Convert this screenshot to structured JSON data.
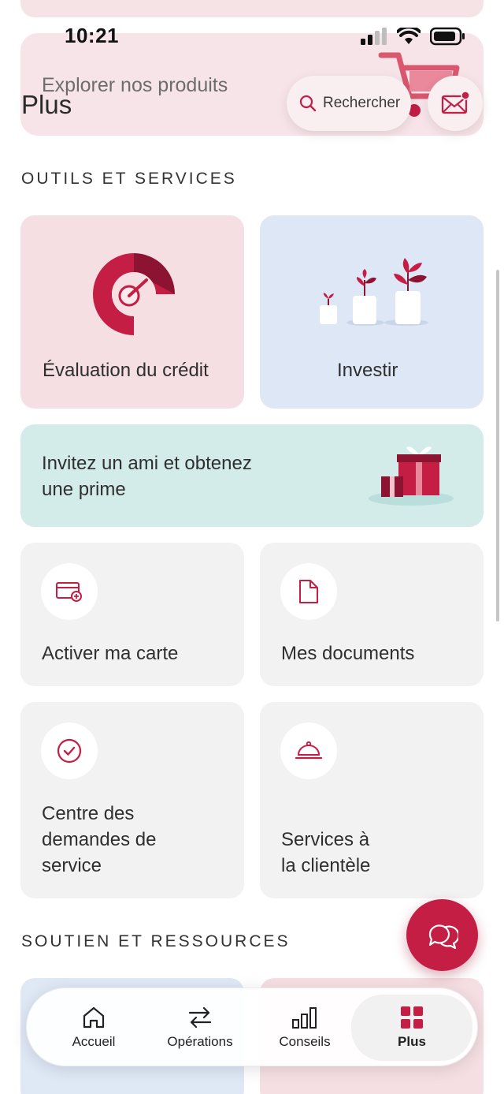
{
  "status_bar": {
    "time": "10:21"
  },
  "header": {
    "title": "Plus",
    "promo_text": "Explorer nos produits",
    "search_label": "Rechercher"
  },
  "sections": {
    "tools_title": "OUTILS ET SERVICES",
    "support_title": "SOUTIEN ET RESSOURCES"
  },
  "tiles": {
    "credit": "Évaluation du crédit",
    "invest": "Investir",
    "invite_line1": "Invitez un ami et obtenez",
    "invite_line2": "une prime",
    "activate_card": "Activer ma carte",
    "documents": "Mes documents",
    "service_requests_l1": "Centre des",
    "service_requests_l2": "demandes de",
    "service_requests_l3": "service",
    "customer_service_l1": "Services à",
    "customer_service_l2": "la clientèle"
  },
  "tabbar": {
    "items": [
      {
        "label": "Accueil",
        "icon": "home-icon"
      },
      {
        "label": "Opérations",
        "icon": "transfer-arrows-icon"
      },
      {
        "label": "Conseils",
        "icon": "bar-chart-icon"
      },
      {
        "label": "Plus",
        "icon": "grid-icon",
        "active": true
      }
    ]
  },
  "colors": {
    "brand_red": "#c41e45",
    "pink_tile": "#f5dfe3",
    "blue_tile": "#dde7f5",
    "teal_tile": "#d3ecea",
    "grey_tile": "#f2f2f2"
  }
}
